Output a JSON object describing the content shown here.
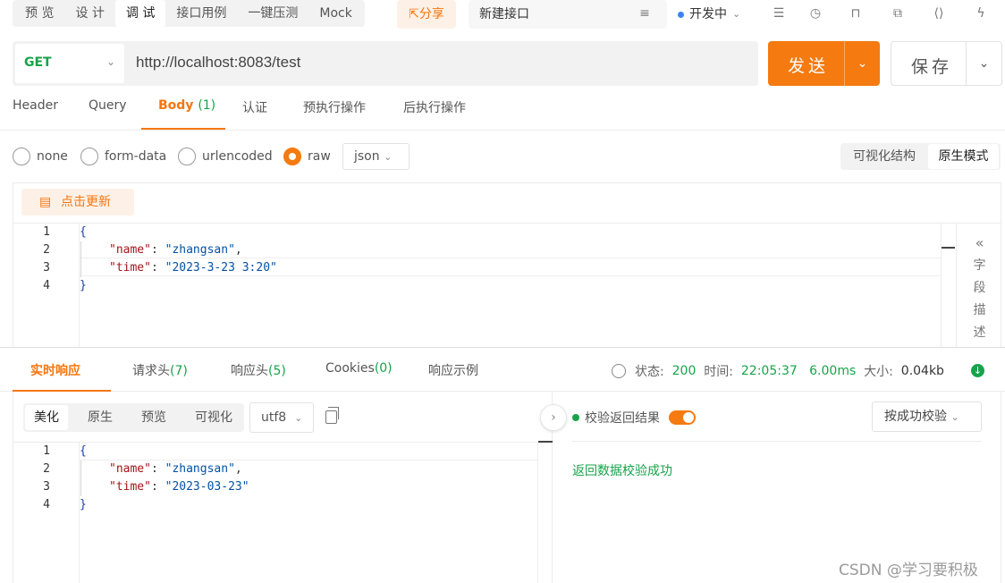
{
  "top_tabs": [
    "预 览",
    "设 计",
    "调 试",
    "接口用例",
    "一键压测",
    "Mock"
  ],
  "share_label": "分享",
  "api_name": "新建接口",
  "environment": "开发中",
  "request": {
    "method": "GET",
    "url": "http://localhost:8083/test",
    "send_label": "发送",
    "save_label": "保存"
  },
  "request_tabs": [
    {
      "label": "Header",
      "count": ""
    },
    {
      "label": "Query",
      "count": ""
    },
    {
      "label": "Body",
      "count": "(1)"
    },
    {
      "label": "认证",
      "count": ""
    },
    {
      "label": "预执行操作",
      "count": ""
    },
    {
      "label": "后执行操作",
      "count": ""
    }
  ],
  "body_types": [
    "none",
    "form-data",
    "urlencoded",
    "raw"
  ],
  "body_selected": "raw",
  "raw_format": "json",
  "view_modes": [
    "可视化结构",
    "原生模式"
  ],
  "view_selected": "原生模式",
  "refresh_label": "点击更新",
  "request_body_lines": [
    {
      "n": "1",
      "key": "",
      "value": "",
      "text": "{"
    },
    {
      "n": "2",
      "key": "\"name\"",
      "value": "\"zhangsan\"",
      "text": ""
    },
    {
      "n": "3",
      "key": "\"time\"",
      "value": "\"2023-3-23 3:20\"",
      "text": ""
    },
    {
      "n": "4",
      "key": "",
      "value": "",
      "text": "}"
    }
  ],
  "field_desc_chars": [
    "字",
    "段",
    "描",
    "述"
  ],
  "response_tabs": [
    {
      "label": "实时响应",
      "count": ""
    },
    {
      "label": "请求头",
      "count": "(7)"
    },
    {
      "label": "响应头",
      "count": "(5)"
    },
    {
      "label": "Cookies",
      "count": "(0)"
    },
    {
      "label": "响应示例",
      "count": ""
    }
  ],
  "status": {
    "status_label": "状态:",
    "status_value": "200",
    "time_label": "时间:",
    "time_value": "22:05:37",
    "duration": "6.00ms",
    "size_label": "大小:",
    "size_value": "0.04kb"
  },
  "format_tabs": [
    "美化",
    "原生",
    "预览",
    "可视化"
  ],
  "format_selected": "美化",
  "encoding": "utf8",
  "response_body_lines": [
    {
      "n": "1",
      "key": "",
      "value": "",
      "text": "{"
    },
    {
      "n": "2",
      "key": "\"name\"",
      "value": "\"zhangsan\"",
      "text": ""
    },
    {
      "n": "3",
      "key": "\"time\"",
      "value": "\"2023-03-23\"",
      "text": ""
    },
    {
      "n": "4",
      "key": "",
      "value": "",
      "text": "}"
    }
  ],
  "validate_label": "校验返回结果",
  "validate_select": "按成功校验",
  "validate_result": "返回数据校验成功",
  "watermark": "CSDN @学习要积极",
  "colors": {
    "accent": "#f57a10",
    "success": "#17a34a",
    "method_get": "#17a34a"
  }
}
